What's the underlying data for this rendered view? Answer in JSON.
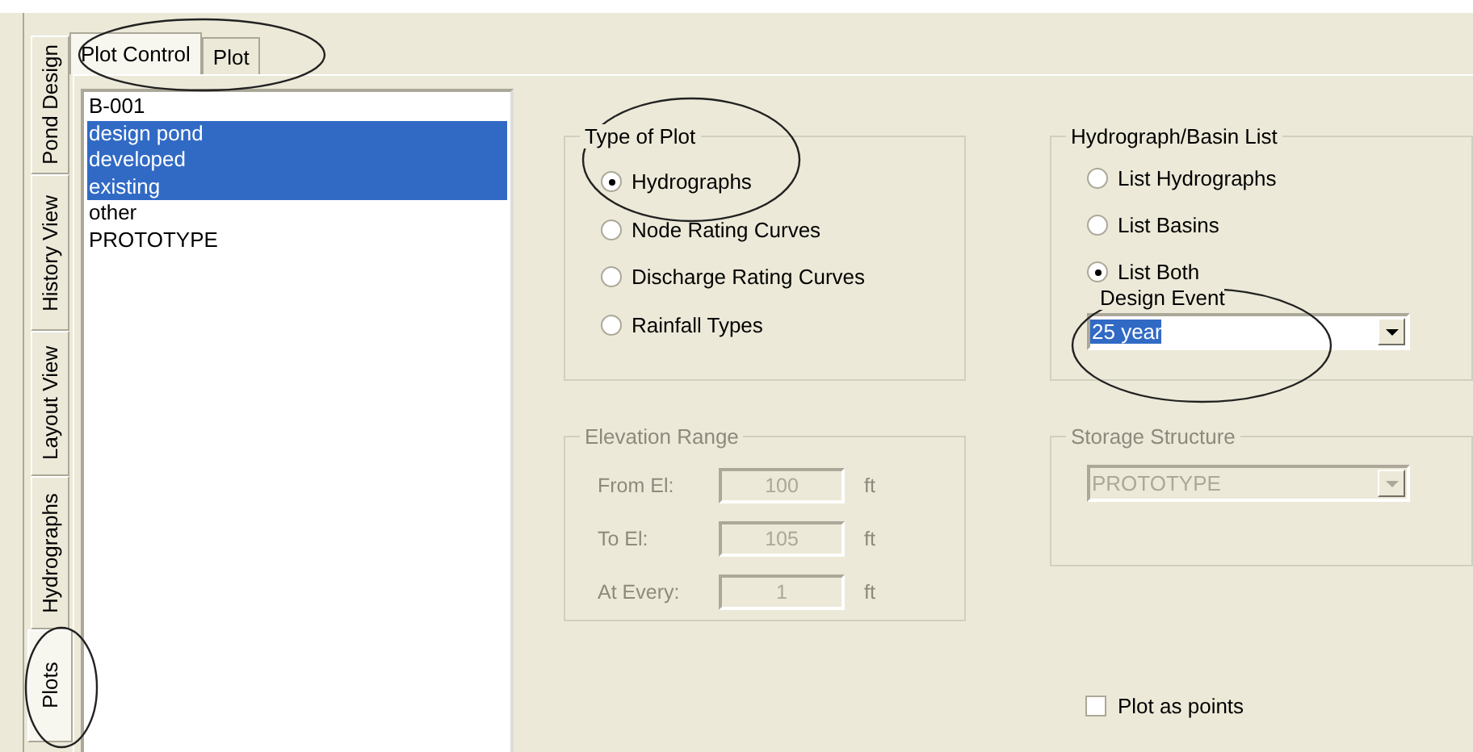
{
  "side_tabs": [
    {
      "label": "Pond Design",
      "selected": false
    },
    {
      "label": "History View",
      "selected": false
    },
    {
      "label": "Layout View",
      "selected": false
    },
    {
      "label": "Hydrographs",
      "selected": false
    },
    {
      "label": "Plots",
      "selected": true
    }
  ],
  "tabs": [
    {
      "label": "Plot Control",
      "selected": true
    },
    {
      "label": "Plot",
      "selected": false
    }
  ],
  "list": {
    "items": [
      {
        "label": "B-001",
        "selected": false
      },
      {
        "label": "design pond",
        "selected": true
      },
      {
        "label": "developed",
        "selected": true
      },
      {
        "label": "existing",
        "selected": true
      },
      {
        "label": "other",
        "selected": false
      },
      {
        "label": "PROTOTYPE",
        "selected": false
      }
    ]
  },
  "type_of_plot": {
    "title": "Type of Plot",
    "options": [
      {
        "label": "Hydrographs",
        "selected": true
      },
      {
        "label": "Node Rating Curves",
        "selected": false
      },
      {
        "label": "Discharge Rating Curves",
        "selected": false
      },
      {
        "label": "Rainfall Types",
        "selected": false
      }
    ]
  },
  "hydrograph_basin_list": {
    "title": "Hydrograph/Basin List",
    "options": [
      {
        "label": "List Hydrographs",
        "selected": false
      },
      {
        "label": "List Basins",
        "selected": false
      },
      {
        "label": "List Both",
        "selected": true
      }
    ],
    "design_event": {
      "label": "Design Event",
      "value": "25 year"
    }
  },
  "elevation_range": {
    "title": "Elevation Range",
    "disabled": true,
    "rows": [
      {
        "label": "From El:",
        "value": "100",
        "unit": "ft"
      },
      {
        "label": "To El:",
        "value": "105",
        "unit": "ft"
      },
      {
        "label": "At Every:",
        "value": "1",
        "unit": "ft"
      }
    ]
  },
  "storage_structure": {
    "title": "Storage Structure",
    "disabled": true,
    "value": "PROTOTYPE"
  },
  "plot_as_points": {
    "label": "Plot as points",
    "checked": false
  }
}
